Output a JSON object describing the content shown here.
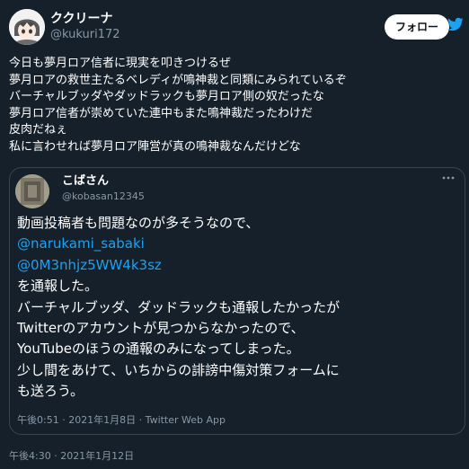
{
  "author": {
    "display_name": "ククリーナ",
    "handle": "@kukuri172",
    "avatar_icon": "anime-character-avatar"
  },
  "follow_button": {
    "label": "フォロー"
  },
  "brand_icon": "twitter-bird-icon",
  "colors": {
    "background": "#15202b",
    "link": "#1da1f2",
    "secondary_text": "#8899a6",
    "border": "#38444d"
  },
  "tweet_text": [
    "今日も夢月ロア信者に現実を叩きつけるぜ",
    "夢月ロアの救世主たるベレディが鳴神裁と同類にみられているぞ",
    "バーチャルブッダやダッドラックも夢月ロア側の奴だったな",
    "夢月ロア信者が崇めていた連中もまた鳴神裁だったわけだ",
    "皮肉だねぇ",
    "私に言わせれば夢月ロア陣営が真の鳴神裁なんだけどな"
  ],
  "quoted_tweet": {
    "display_name": "こばさん",
    "handle": "@kobasan12345",
    "avatar_icon": "photo-avatar",
    "more_icon": "more-options-icon",
    "lines": [
      {
        "text": "動画投稿者も問題なのが多そうなので、",
        "link": false
      },
      {
        "text": "@narukami_sabaki",
        "link": true
      },
      {
        "text": "@0M3nhjz5WW4k3sz",
        "link": true
      },
      {
        "text": "を通報した。",
        "link": false
      },
      {
        "text": "バーチャルブッダ、ダッドラックも通報したかったが",
        "link": false
      },
      {
        "text": "Twitterのアカウントが見つからなかったので、",
        "link": false
      },
      {
        "text": "YouTubeのほうの通報のみになってしまった。",
        "link": false
      },
      {
        "text": "少し間をあけて、いちからの誹謗中傷対策フォームに",
        "link": false
      },
      {
        "text": "も送ろう。",
        "link": false
      }
    ],
    "meta": "午後0:51 · 2021年1月8日 · Twitter Web App"
  },
  "timestamp": "午後4:30 · 2021年1月12日"
}
